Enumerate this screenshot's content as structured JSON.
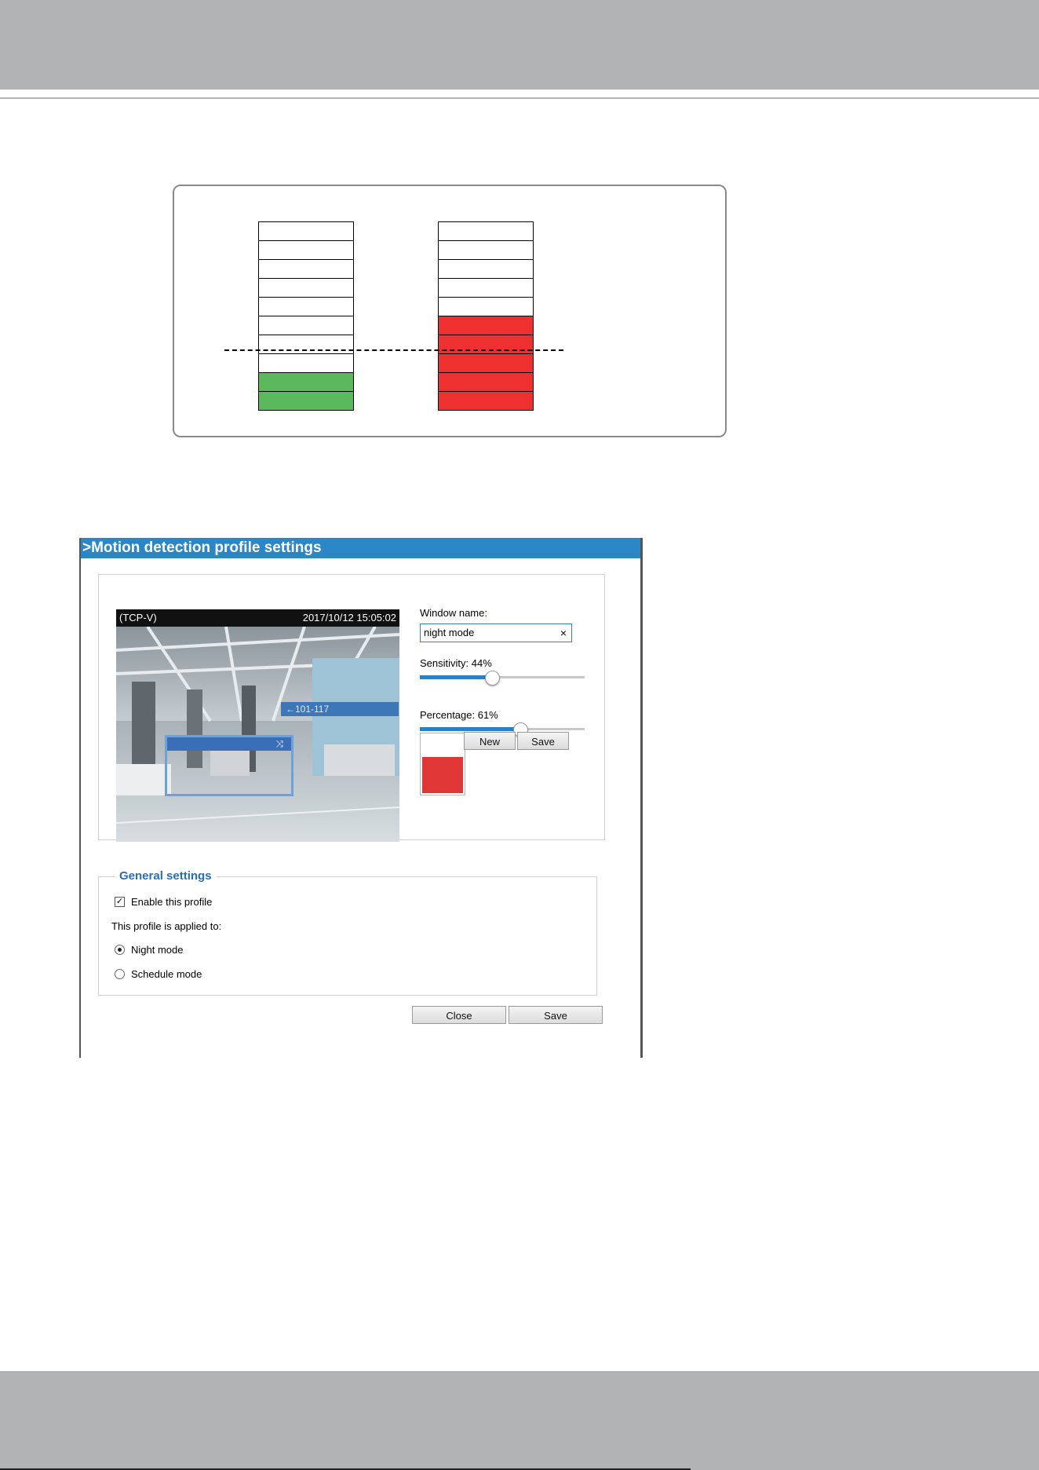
{
  "diagram": {
    "bar1": {
      "segments": 10,
      "filled": 2,
      "fill_color": "#5cb85c"
    },
    "bar2": {
      "segments": 10,
      "filled": 5,
      "fill_color": "#ee3030"
    }
  },
  "window": {
    "title": ">Motion detection profile settings",
    "video": {
      "source": "(TCP-V)",
      "timestamp": "2017/10/12 15:05:02",
      "sign_text": "←101-117",
      "window_close_glyph": "⤨"
    },
    "window_name_label": "Window name:",
    "window_name_value": "night mode",
    "clear_glyph": "×",
    "sensitivity_label": "Sensitivity: 44%",
    "sensitivity_value": 44,
    "percentage_label": "Percentage: 61%",
    "percentage_value": 61,
    "new_button": "New",
    "save_button": "Save",
    "preview_fill_color": "#e03636",
    "preview_level": 61
  },
  "general": {
    "legend": "General settings",
    "enable_label": "Enable this profile",
    "enable_checked": true,
    "applied_to_label": "This profile is applied to:",
    "night_mode_label": "Night mode",
    "schedule_mode_label": "Schedule mode",
    "selected_mode": "Night mode"
  },
  "footer_buttons": {
    "close": "Close",
    "save": "Save"
  }
}
